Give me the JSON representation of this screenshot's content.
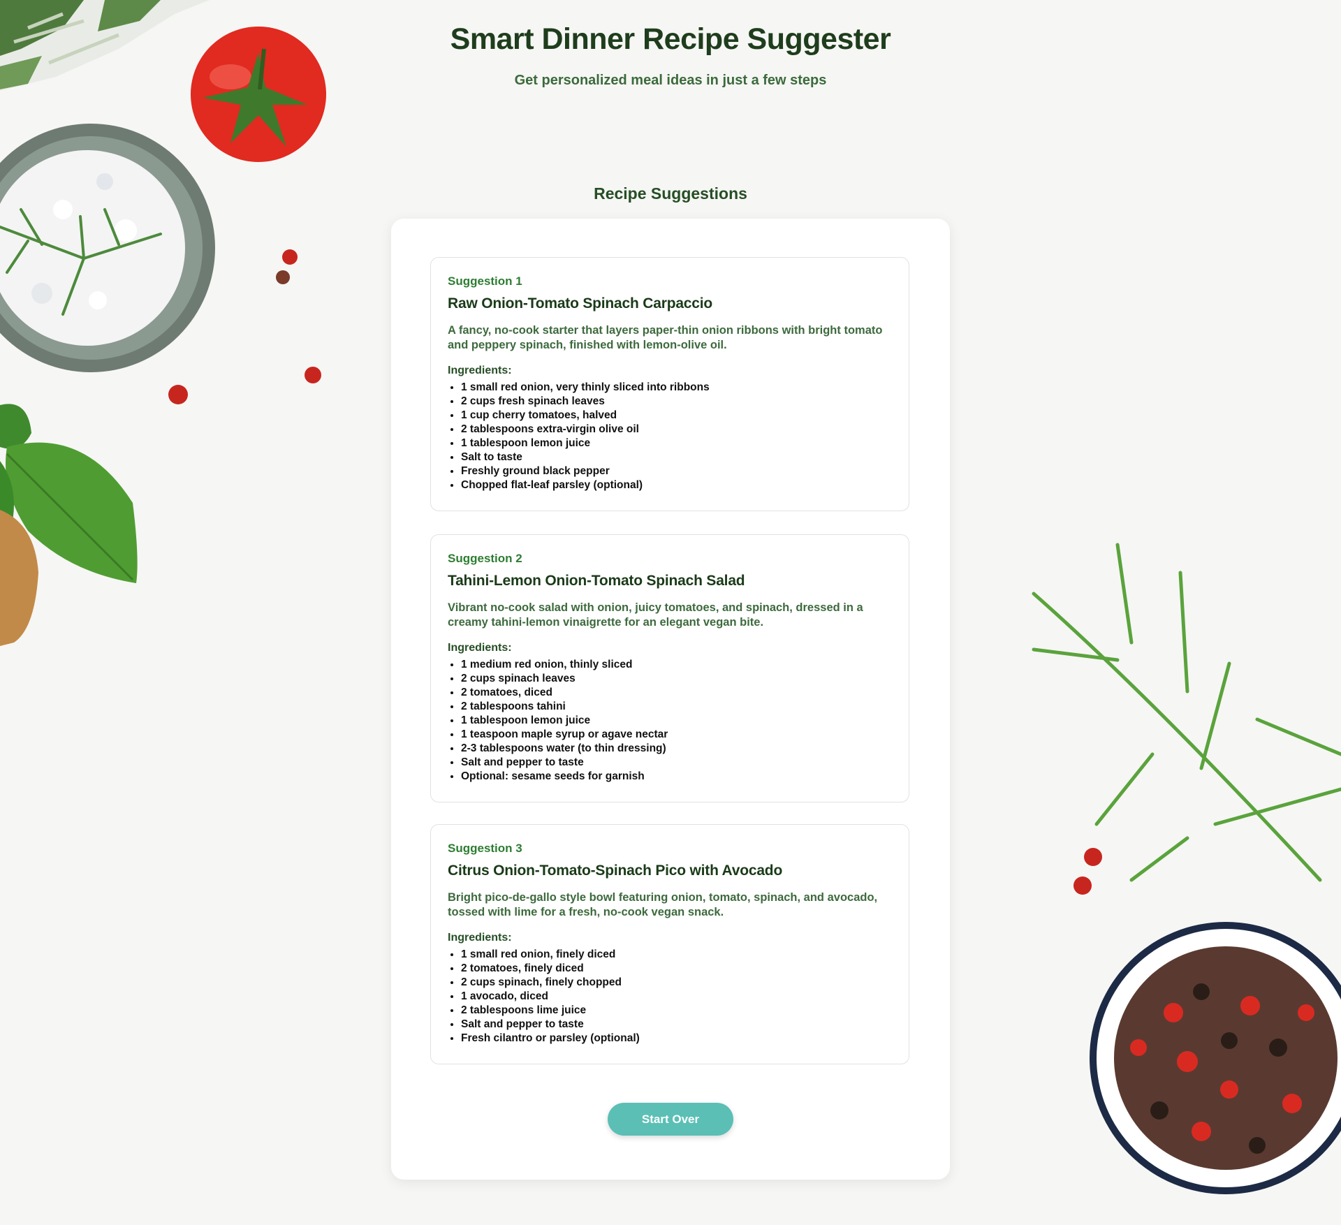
{
  "header": {
    "title": "Smart Dinner Recipe Suggester",
    "subtitle": "Get personalized meal ideas in just a few steps"
  },
  "section_title": "Recipe Suggestions",
  "suggestions": [
    {
      "label": "Suggestion 1",
      "title": "Raw Onion-Tomato Spinach Carpaccio",
      "description": "A fancy, no-cook starter that layers paper-thin onion ribbons with bright tomato and peppery spinach, finished with lemon-olive oil.",
      "ingredients_label": "Ingredients:",
      "ingredients": [
        "1 small red onion, very thinly sliced into ribbons",
        "2 cups fresh spinach leaves",
        "1 cup cherry tomatoes, halved",
        "2 tablespoons extra-virgin olive oil",
        "1 tablespoon lemon juice",
        "Salt to taste",
        "Freshly ground black pepper",
        "Chopped flat-leaf parsley (optional)"
      ]
    },
    {
      "label": "Suggestion 2",
      "title": "Tahini-Lemon Onion-Tomato Spinach Salad",
      "description": "Vibrant no-cook salad with onion, juicy tomatoes, and spinach, dressed in a creamy tahini-lemon vinaigrette for an elegant vegan bite.",
      "ingredients_label": "Ingredients:",
      "ingredients": [
        "1 medium red onion, thinly sliced",
        "2 cups spinach leaves",
        "2 tomatoes, diced",
        "2 tablespoons tahini",
        "1 tablespoon lemon juice",
        "1 teaspoon maple syrup or agave nectar",
        "2-3 tablespoons water (to thin dressing)",
        "Salt and pepper to taste",
        "Optional: sesame seeds for garnish"
      ]
    },
    {
      "label": "Suggestion 3",
      "title": "Citrus Onion-Tomato-Spinach Pico with Avocado",
      "description": "Bright pico-de-gallo style bowl featuring onion, tomato, spinach, and avocado, tossed with lime for a fresh, no-cook vegan snack.",
      "ingredients_label": "Ingredients:",
      "ingredients": [
        "1 small red onion, finely diced",
        "2 tomatoes, finely diced",
        "2 cups spinach, finely chopped",
        "1 avocado, diced",
        "2 tablespoons lime juice",
        "Salt and pepper to taste",
        "Fresh cilantro or parsley (optional)"
      ]
    }
  ],
  "actions": {
    "start_over": "Start Over"
  },
  "colors": {
    "title": "#1e3d1c",
    "accent_green": "#2e7d32",
    "button_teal": "#5bbfb5"
  },
  "icons": {
    "background_decor": [
      "towel-icon",
      "tomato-icon",
      "salt-bowl-icon",
      "rosemary-icon",
      "peppercorn-icon",
      "basil-icon",
      "wooden-spoon-icon",
      "peppercorn-bowl-icon"
    ]
  }
}
